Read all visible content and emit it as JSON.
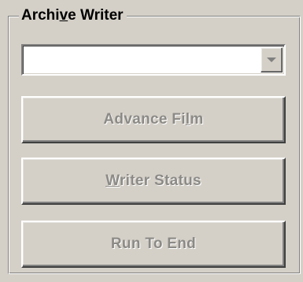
{
  "group": {
    "title_parts": [
      "Archi",
      "v",
      "e Writer"
    ]
  },
  "combo": {
    "value": ""
  },
  "buttons": {
    "advance": [
      "Advance Fi",
      "l",
      "m"
    ],
    "status": [
      "",
      "W",
      "riter Status"
    ],
    "run": [
      "Run To End",
      "",
      ""
    ]
  },
  "colors": {
    "face": "#d4d0c8",
    "disabled_text": "#8c8a86",
    "highlight": "#ffffff",
    "shadow": "#808080"
  },
  "icons": {
    "combo_dropdown": "chevron-down-icon"
  }
}
